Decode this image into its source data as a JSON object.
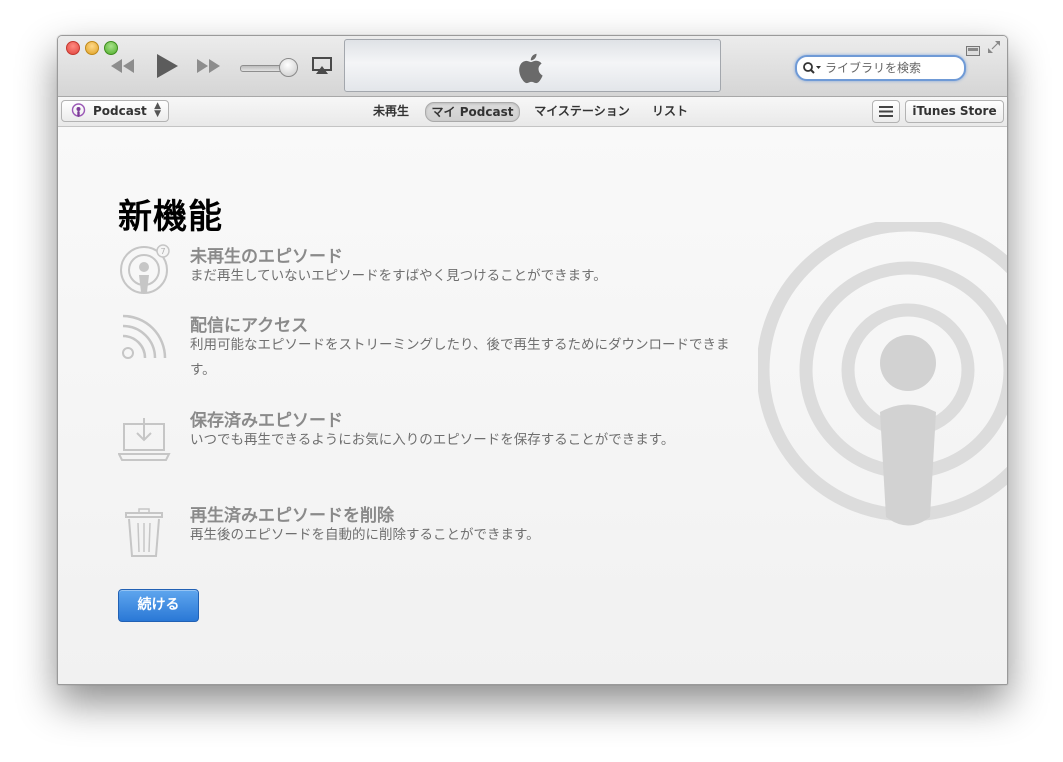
{
  "window": {
    "search": {
      "placeholder": "ライブラリを検索"
    },
    "library_selector": {
      "label": "Podcast"
    },
    "tabs": [
      {
        "label": "未再生",
        "active": false
      },
      {
        "label": "マイ Podcast",
        "active": true
      },
      {
        "label": "マイステーション",
        "active": false
      },
      {
        "label": "リスト",
        "active": false
      }
    ],
    "store_button": "iTunes Store"
  },
  "content": {
    "title": "新機能",
    "features": [
      {
        "icon": "podcast-badge-icon",
        "title": "未再生のエピソード",
        "description": "まだ再生していないエピソードをすばやく見つけることができます。"
      },
      {
        "icon": "stream-icon",
        "title": "配信にアクセス",
        "description": "利用可能なエピソードをストリーミングしたり、後で再生するためにダウンロードできます。"
      },
      {
        "icon": "download-laptop-icon",
        "title": "保存済みエピソード",
        "description": "いつでも再生できるようにお気に入りのエピソードを保存することができます。"
      },
      {
        "icon": "trash-icon",
        "title": "再生済みエピソードを削除",
        "description": "再生後のエピソードを自動的に削除することができます。"
      }
    ],
    "continue_button": "続ける"
  },
  "colors": {
    "accent": "#2a78d6",
    "search_ring": "#6f9ad6"
  }
}
